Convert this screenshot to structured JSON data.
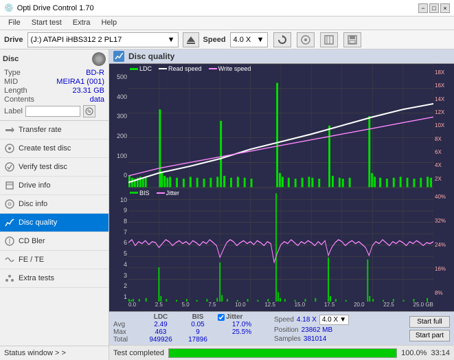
{
  "app": {
    "title": "Opti Drive Control 1.70",
    "title_icon": "💿"
  },
  "titlebar": {
    "title": "Opti Drive Control 1.70",
    "minimize_label": "−",
    "maximize_label": "□",
    "close_label": "×"
  },
  "menubar": {
    "items": [
      "File",
      "Start test",
      "Extra",
      "Help"
    ]
  },
  "drivebar": {
    "drive_label": "Drive",
    "drive_value": "(J:)  ATAPI iHBS312  2 PL17",
    "speed_label": "Speed",
    "speed_value": "4.0 X"
  },
  "disc_info": {
    "title": "Disc",
    "type_label": "Type",
    "type_value": "BD-R",
    "mid_label": "MID",
    "mid_value": "MEIRA1 (001)",
    "length_label": "Length",
    "length_value": "23.31 GB",
    "contents_label": "Contents",
    "contents_value": "data",
    "label_label": "Label"
  },
  "sidebar_items": [
    {
      "id": "transfer-rate",
      "label": "Transfer rate",
      "active": false
    },
    {
      "id": "create-test-disc",
      "label": "Create test disc",
      "active": false
    },
    {
      "id": "verify-test-disc",
      "label": "Verify test disc",
      "active": false
    },
    {
      "id": "drive-info",
      "label": "Drive info",
      "active": false
    },
    {
      "id": "disc-info",
      "label": "Disc info",
      "active": false
    },
    {
      "id": "disc-quality",
      "label": "Disc quality",
      "active": true
    },
    {
      "id": "cd-bler",
      "label": "CD Bler",
      "active": false
    },
    {
      "id": "fe-te",
      "label": "FE / TE",
      "active": false
    },
    {
      "id": "extra-tests",
      "label": "Extra tests",
      "active": false
    }
  ],
  "status_window": {
    "label": "Status window > >"
  },
  "disc_quality": {
    "title": "Disc quality",
    "legend": {
      "ldc": "LDC",
      "read_speed": "Read speed",
      "write_speed": "Write speed",
      "bis": "BIS",
      "jitter": "Jitter"
    },
    "chart1": {
      "y_labels_left": [
        "500",
        "400",
        "300",
        "200",
        "100",
        "0"
      ],
      "y_labels_right": [
        "18X",
        "16X",
        "14X",
        "12X",
        "10X",
        "8X",
        "6X",
        "4X",
        "2X"
      ],
      "x_labels": [
        "0.0",
        "2.5",
        "5.0",
        "7.5",
        "10.0",
        "12.5",
        "15.0",
        "17.5",
        "20.0",
        "22.5",
        "25.0 GB"
      ]
    },
    "chart2": {
      "y_labels_left": [
        "10",
        "9",
        "8",
        "7",
        "6",
        "5",
        "4",
        "3",
        "2",
        "1"
      ],
      "y_labels_right": [
        "40%",
        "32%",
        "24%",
        "16%",
        "8%"
      ],
      "x_labels": [
        "0.0",
        "2.5",
        "5.0",
        "7.5",
        "10.0",
        "12.5",
        "15.0",
        "17.5",
        "20.0",
        "22.5",
        "25.0 GB"
      ]
    }
  },
  "stats": {
    "ldc_header": "LDC",
    "bis_header": "BIS",
    "jitter_header": "Jitter",
    "jitter_checked": true,
    "avg_label": "Avg",
    "avg_ldc": "2.49",
    "avg_bis": "0.05",
    "avg_jitter": "17.0%",
    "max_label": "Max",
    "max_ldc": "463",
    "max_bis": "9",
    "max_jitter": "25.5%",
    "total_label": "Total",
    "total_ldc": "949926",
    "total_bis": "17896",
    "speed_label": "Speed",
    "speed_value": "4.18 X",
    "speed_select": "4.0 X",
    "position_label": "Position",
    "position_value": "23862 MB",
    "samples_label": "Samples",
    "samples_value": "381014",
    "start_full_label": "Start full",
    "start_part_label": "Start part"
  },
  "progress": {
    "label": "Test completed",
    "percent": "100.0%",
    "percent_num": 100,
    "time": "33:14"
  },
  "colors": {
    "ldc_bar": "#00dd00",
    "read_speed": "#ffffff",
    "write_speed": "#ff88ff",
    "bis_bar": "#00cc00",
    "jitter_line": "#ff88ff",
    "accent": "#0078d7",
    "chart_bg": "#2a2a4a",
    "sidebar_active": "#0078d7"
  }
}
